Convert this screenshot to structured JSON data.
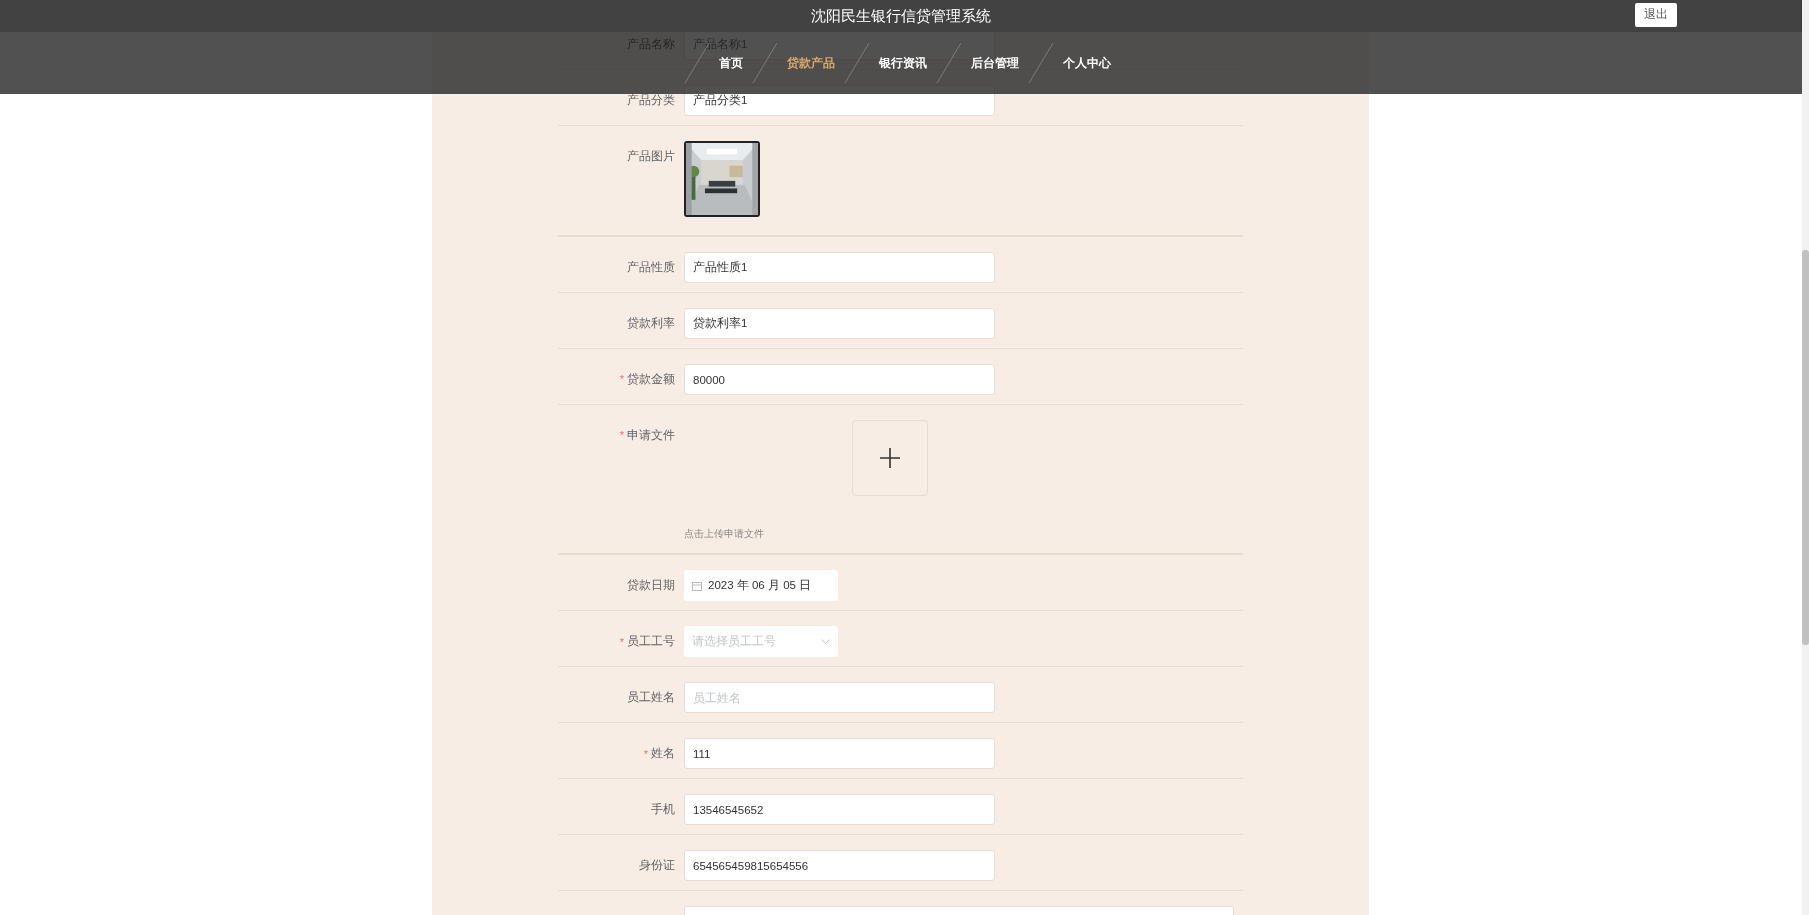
{
  "header": {
    "title": "沈阳民生银行信贷管理系统",
    "logout": "退出"
  },
  "nav": [
    {
      "label": "首页",
      "selected": false
    },
    {
      "label": "贷款产品",
      "selected": true
    },
    {
      "label": "银行资讯",
      "selected": false
    },
    {
      "label": "后台管理",
      "selected": false
    },
    {
      "label": "个人中心",
      "selected": false
    }
  ],
  "form": {
    "required_mark": "*",
    "rows": [
      {
        "kind": "text",
        "label": "产品名称",
        "required": false,
        "value": "产品名称1"
      },
      {
        "kind": "text",
        "label": "产品分类",
        "required": false,
        "value": "产品分类1"
      },
      {
        "label": "产品图片",
        "required": false
      },
      {
        "kind": "text",
        "label": "产品性质",
        "required": false,
        "value": "产品性质1"
      },
      {
        "kind": "text",
        "label": "贷款利率",
        "required": false,
        "value": "贷款利率1"
      },
      {
        "kind": "text",
        "label": "贷款金额",
        "required": true,
        "value": "80000"
      },
      {
        "kind": "upload",
        "label": "申请文件",
        "required": true,
        "hint": "点击上传申请文件"
      },
      {
        "kind": "date",
        "label": "贷款日期",
        "required": false,
        "value": "2023 年 06 月 05 日"
      },
      {
        "kind": "select",
        "label": "员工工号",
        "required": true,
        "placeholder": "请选择员工工号"
      },
      {
        "kind": "text",
        "label": "员工姓名",
        "required": false,
        "placeholder": "员工姓名"
      },
      {
        "kind": "text",
        "label": "姓名",
        "required": true,
        "value": "111"
      },
      {
        "kind": "text",
        "label": "手机",
        "required": false,
        "value": "13546545652"
      },
      {
        "kind": "text",
        "label": "身份证",
        "required": false,
        "value": "654565459815654556"
      },
      {
        "kind": "partial"
      }
    ]
  }
}
